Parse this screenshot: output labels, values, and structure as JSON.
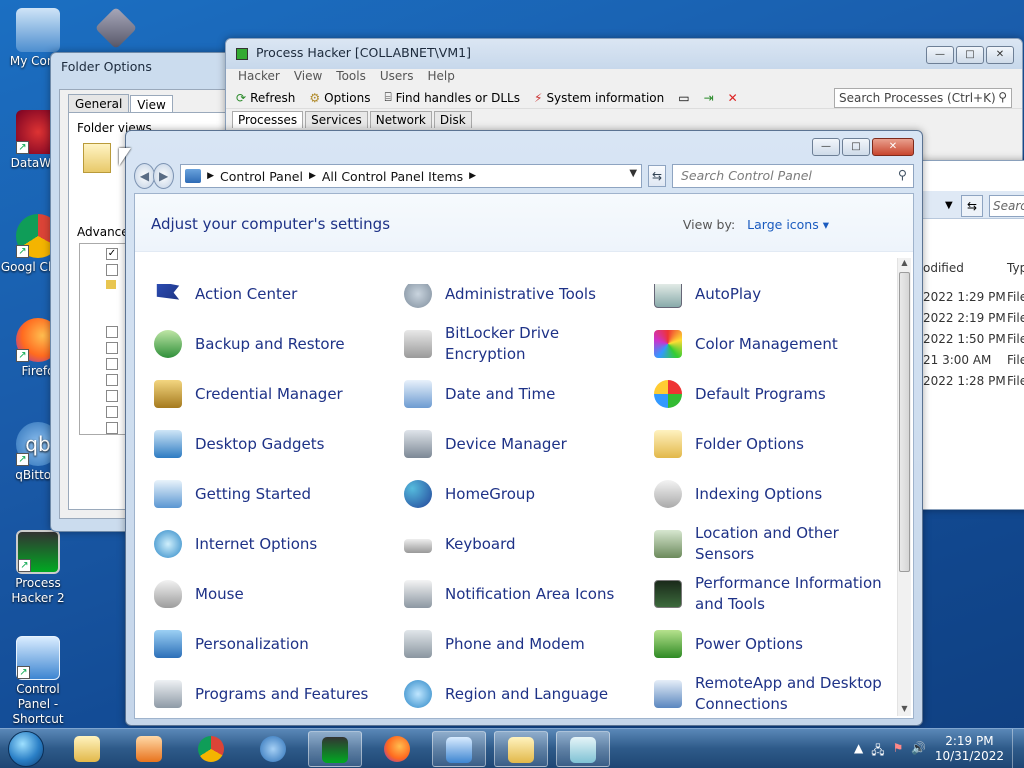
{
  "desktop": {
    "icons": [
      {
        "label": "My Comp"
      },
      {
        "label": "DataWag"
      },
      {
        "label": "Googl Chron"
      },
      {
        "label": "Firefo"
      },
      {
        "label": "qBittorr"
      },
      {
        "label": "Process Hacker 2"
      },
      {
        "label": "Control Panel - Shortcut"
      }
    ]
  },
  "folder_options": {
    "title": "Folder Options",
    "tabs": [
      "General",
      "View"
    ],
    "group_label": "Folder views",
    "advanced_label": "Advance"
  },
  "process_hacker": {
    "title": "Process Hacker [COLLABNET\\VM1]",
    "menu": [
      "Hacker",
      "View",
      "Tools",
      "Users",
      "Help"
    ],
    "toolbar": {
      "refresh": "Refresh",
      "options": "Options",
      "find_handles": "Find handles or DLLs",
      "system_information": "System information"
    },
    "search_placeholder": "Search Processes (Ctrl+K)",
    "tabs": [
      "Processes",
      "Services",
      "Network",
      "Disk"
    ]
  },
  "explorer_bg": {
    "search_placeholder": "Searc",
    "col_modified": "odified",
    "col_type": "Typ",
    "rows": [
      {
        "modified": "2022 1:29 PM",
        "type": "File"
      },
      {
        "modified": "2022 2:19 PM",
        "type": "File"
      },
      {
        "modified": "2022 1:50 PM",
        "type": "File"
      },
      {
        "modified": "21 3:00 AM",
        "type": "File"
      },
      {
        "modified": "2022 1:28 PM",
        "type": "File"
      }
    ]
  },
  "control_panel": {
    "breadcrumb": [
      "Control Panel",
      "All Control Panel Items"
    ],
    "search_placeholder": "Search Control Panel",
    "heading": "Adjust your computer's settings",
    "view_by_label": "View by:",
    "view_by_value": "Large icons ▾",
    "items": [
      {
        "label": "Action Center",
        "icon": "flag-icon"
      },
      {
        "label": "Administrative Tools",
        "icon": "gears-icon"
      },
      {
        "label": "AutoPlay",
        "icon": "autoplay-icon"
      },
      {
        "label": "Backup and Restore",
        "icon": "backup-icon"
      },
      {
        "label": "BitLocker Drive Encryption",
        "icon": "bitlocker-key-icon"
      },
      {
        "label": "Color Management",
        "icon": "color-icon"
      },
      {
        "label": "Credential Manager",
        "icon": "vault-icon"
      },
      {
        "label": "Date and Time",
        "icon": "calendar-clock-icon"
      },
      {
        "label": "Default Programs",
        "icon": "default-programs-icon"
      },
      {
        "label": "Desktop Gadgets",
        "icon": "gadgets-icon"
      },
      {
        "label": "Device Manager",
        "icon": "device-manager-icon"
      },
      {
        "label": "Folder Options",
        "icon": "folder-icon"
      },
      {
        "label": "Getting Started",
        "icon": "getting-started-icon"
      },
      {
        "label": "HomeGroup",
        "icon": "homegroup-icon"
      },
      {
        "label": "Indexing Options",
        "icon": "indexing-icon"
      },
      {
        "label": "Internet Options",
        "icon": "internet-icon"
      },
      {
        "label": "Keyboard",
        "icon": "keyboard-icon"
      },
      {
        "label": "Location and Other Sensors",
        "icon": "sensor-icon"
      },
      {
        "label": "Mouse",
        "icon": "mouse-icon"
      },
      {
        "label": "Notification Area Icons",
        "icon": "notification-icon"
      },
      {
        "label": "Performance Information and Tools",
        "icon": "performance-icon"
      },
      {
        "label": "Personalization",
        "icon": "personalization-icon"
      },
      {
        "label": "Phone and Modem",
        "icon": "phone-icon"
      },
      {
        "label": "Power Options",
        "icon": "power-icon"
      },
      {
        "label": "Programs and Features",
        "icon": "programs-icon"
      },
      {
        "label": "Region and Language",
        "icon": "globe-clock-icon"
      },
      {
        "label": "RemoteApp and Desktop Connections",
        "icon": "remoteapp-icon"
      }
    ]
  },
  "taskbar": {
    "time": "2:19 PM",
    "date": "10/31/2022"
  },
  "colors": {
    "link_blue": "#1e3287",
    "desktop_blue": "#1a5aa8"
  }
}
